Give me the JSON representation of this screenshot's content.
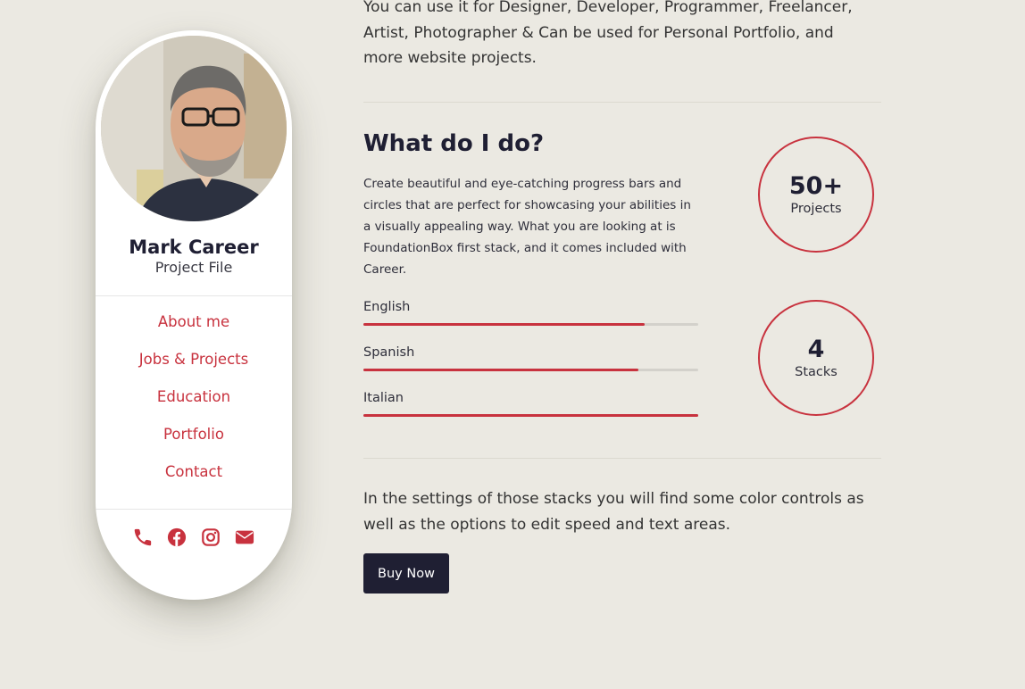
{
  "profile": {
    "name": "Mark Career",
    "role": "Project File"
  },
  "nav": {
    "items": [
      {
        "label": "About me"
      },
      {
        "label": "Jobs & Projects"
      },
      {
        "label": "Education"
      },
      {
        "label": "Portfolio"
      },
      {
        "label": "Contact"
      }
    ]
  },
  "social": {
    "icons": [
      "phone-icon",
      "facebook-icon",
      "instagram-icon",
      "envelope-icon"
    ]
  },
  "content": {
    "intro": "You can use it for Designer, Developer, Programmer, Freelancer, Artist, Photographer & Can be used for Personal Portfolio, and more website projects.",
    "heading": "What do I do?",
    "description": "Create beautiful and eye-catching progress bars and circles that are perfect for showcasing your abilities in a visually appealing way. What you are looking at is FoundationBox first stack, and it comes included with Career.",
    "skills": [
      {
        "label": "English",
        "level": 0.84
      },
      {
        "label": "Spanish",
        "level": 0.82
      },
      {
        "label": "Italian",
        "level": 1.0
      }
    ],
    "stats": [
      {
        "value": "50+",
        "label": "Projects"
      },
      {
        "value": "4",
        "label": "Stacks"
      }
    ],
    "outro": "In the settings of those stacks you will find some color controls as well as the options to edit speed and text areas.",
    "button_label": "Buy Now"
  },
  "colors": {
    "accent": "#c8323e",
    "dark": "#1f1f33",
    "background": "#ebe9e2"
  }
}
